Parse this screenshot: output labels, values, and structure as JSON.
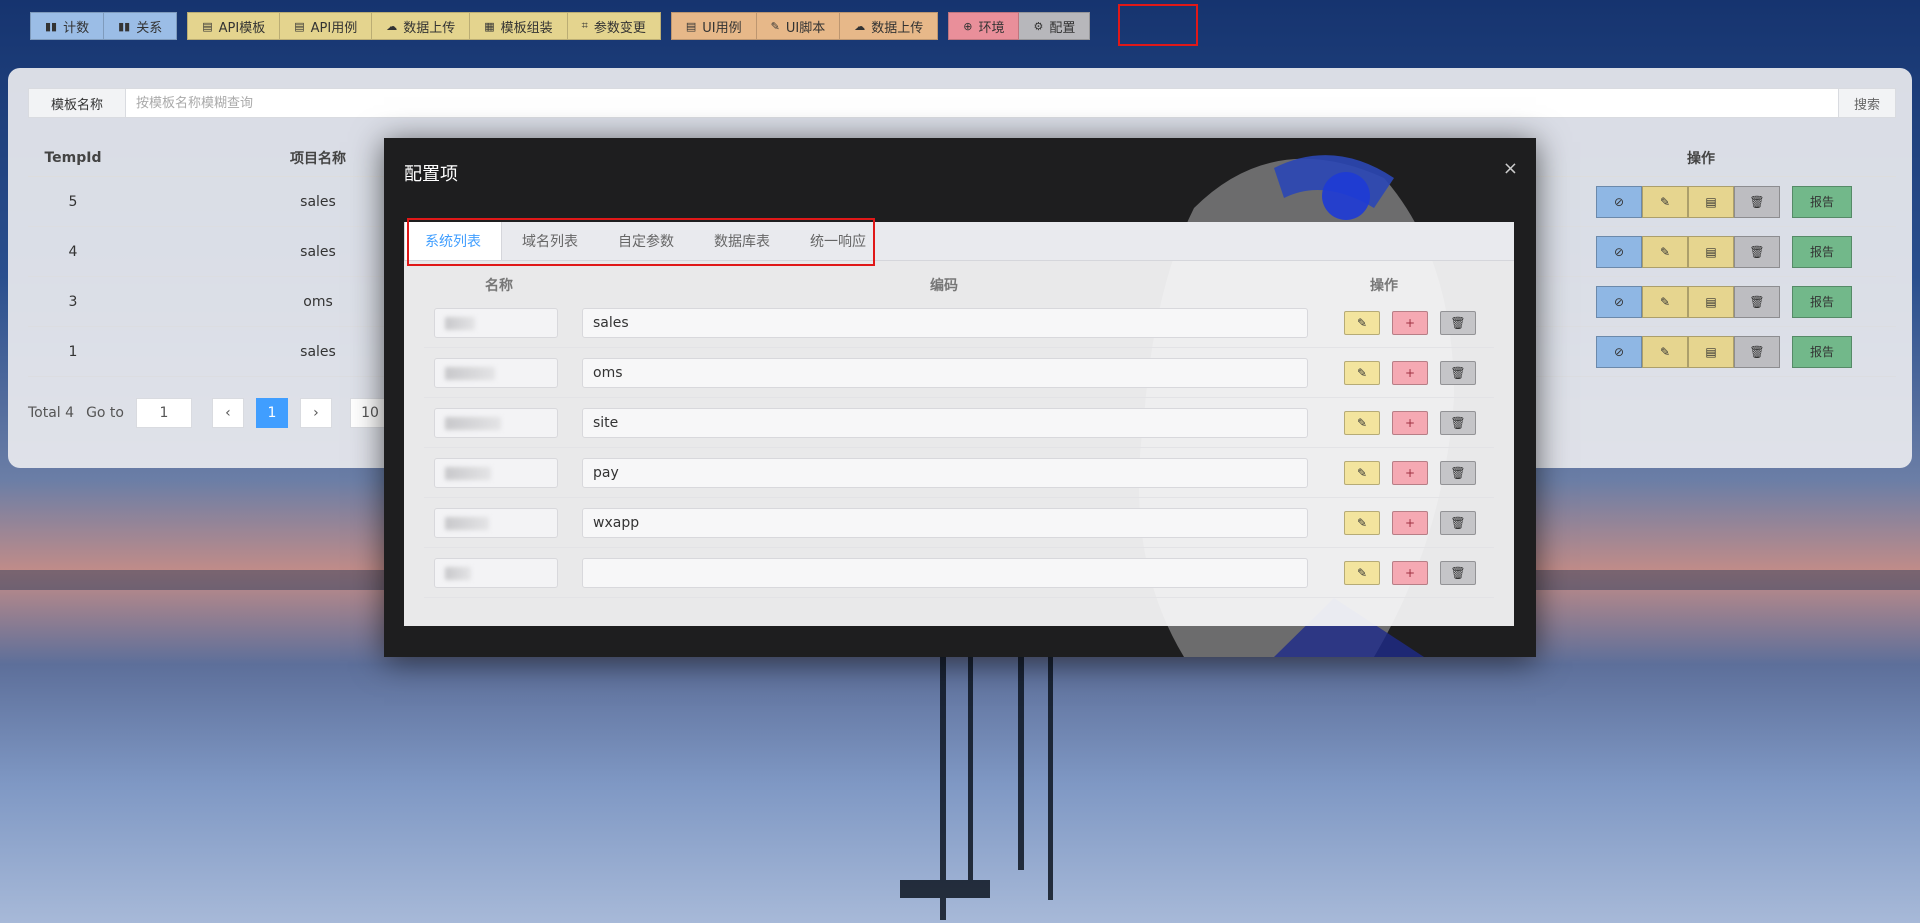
{
  "toolbar": {
    "group1": [
      {
        "label": "计数",
        "icon": "bar-chart-icon"
      },
      {
        "label": "关系",
        "icon": "bar-chart-icon"
      }
    ],
    "group2": [
      {
        "label": "API模板",
        "icon": "clipboard-icon"
      },
      {
        "label": "API用例",
        "icon": "clipboard-icon"
      },
      {
        "label": "数据上传",
        "icon": "cloud-upload-icon"
      },
      {
        "label": "模板组装",
        "icon": "grid-icon"
      },
      {
        "label": "参数变更",
        "icon": "crop-icon"
      }
    ],
    "group3": [
      {
        "label": "UI用例",
        "icon": "clipboard-icon"
      },
      {
        "label": "UI脚本",
        "icon": "edit-icon"
      },
      {
        "label": "数据上传",
        "icon": "cloud-upload-icon"
      }
    ],
    "group4": [
      {
        "label": "环境",
        "icon": "plus-circle-icon"
      },
      {
        "label": "配置",
        "icon": "gear-icon"
      }
    ]
  },
  "search": {
    "label": "模板名称",
    "placeholder": "按模板名称模糊查询",
    "button": "搜索"
  },
  "table": {
    "headers": {
      "id": "TempId",
      "project": "项目名称",
      "ops": "操作"
    },
    "rows": [
      {
        "id": "5",
        "project": "sales"
      },
      {
        "id": "4",
        "project": "sales"
      },
      {
        "id": "3",
        "project": "oms"
      },
      {
        "id": "1",
        "project": "sales"
      }
    ],
    "report_label": "报告"
  },
  "pager": {
    "total": "Total 4",
    "goto": "Go to",
    "goto_value": "1",
    "current": "1",
    "size": "10"
  },
  "modal": {
    "title": "配置项",
    "close": "×",
    "tabs": [
      "系统列表",
      "域名列表",
      "自定参数",
      "数据库表",
      "统一响应"
    ],
    "active_tab": "系统列表",
    "headers": {
      "name": "名称",
      "code": "编码",
      "ops": "操作"
    },
    "rows": [
      {
        "code": "sales"
      },
      {
        "code": "oms"
      },
      {
        "code": "site"
      },
      {
        "code": "pay"
      },
      {
        "code": "wxapp"
      },
      {
        "code": ""
      }
    ]
  },
  "colors": {
    "highlight": "#e01818",
    "active_tab": "#409eff"
  }
}
